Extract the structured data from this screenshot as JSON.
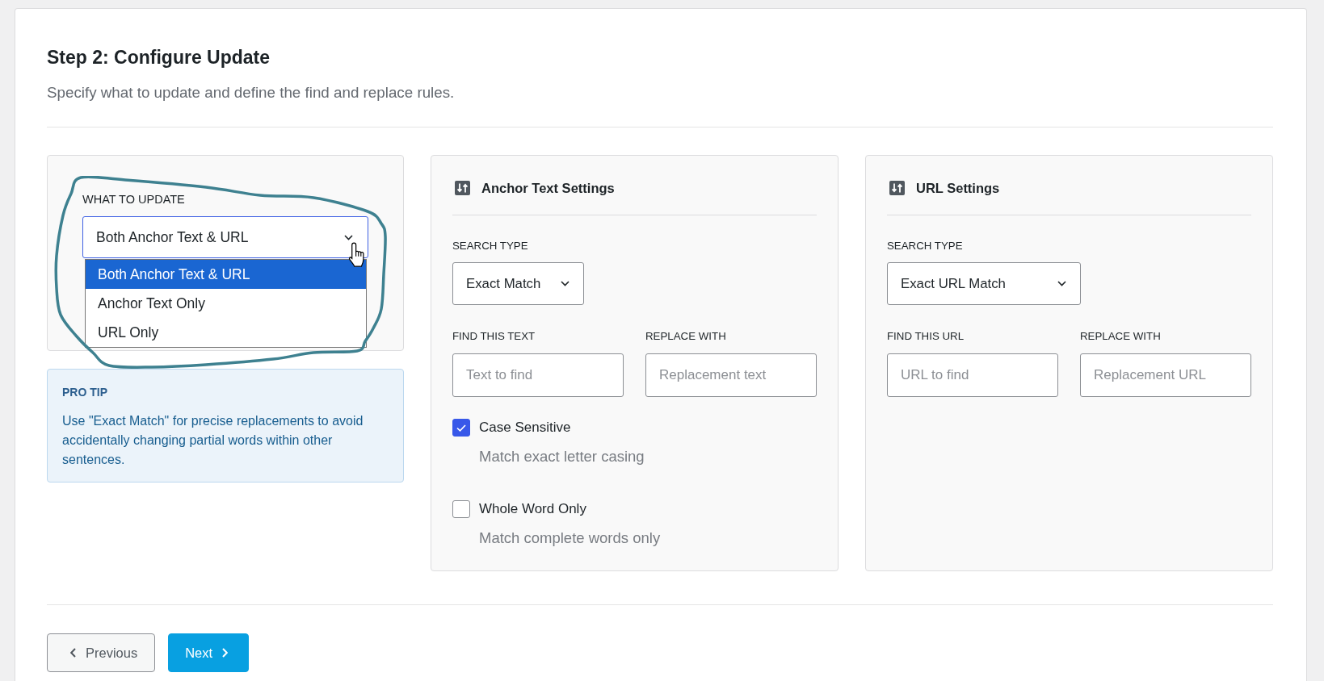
{
  "header": {
    "title": "Step 2: Configure Update",
    "subtitle": "Specify what to update and define the find and replace rules."
  },
  "update_panel": {
    "label": "WHAT TO UPDATE",
    "select": {
      "value": "Both Anchor Text & URL",
      "expanded": true,
      "options": [
        {
          "label": "Both Anchor Text & URL",
          "selected": true
        },
        {
          "label": "Anchor Text Only",
          "selected": false
        },
        {
          "label": "URL Only",
          "selected": false
        }
      ]
    }
  },
  "pro_tip": {
    "title": "PRO TIP",
    "text": "Use \"Exact Match\" for precise replacements to avoid accidentally changing partial words within other sentences."
  },
  "settings_panels": [
    {
      "title": "Anchor Text Settings",
      "search_type": {
        "label": "SEARCH TYPE",
        "value": "Exact Match"
      },
      "fields": [
        {
          "label": "FIND THIS TEXT",
          "placeholder": "Text to find"
        },
        {
          "label": "REPLACE WITH",
          "placeholder": "Replacement text"
        }
      ],
      "options": [
        {
          "label": "Case Sensitive",
          "description": "Match exact letter casing",
          "checked": true
        },
        {
          "label": "Whole Word Only",
          "description": "Match complete words only",
          "checked": false
        }
      ]
    },
    {
      "title": "URL Settings",
      "search_type": {
        "label": "SEARCH TYPE",
        "value": "Exact URL Match"
      },
      "fields": [
        {
          "label": "FIND THIS URL",
          "placeholder": "URL to find"
        },
        {
          "label": "REPLACE WITH",
          "placeholder": "Replacement URL"
        }
      ]
    }
  ],
  "buttons": [
    {
      "label": "Previous",
      "kind": "back"
    },
    {
      "label": "Next",
      "kind": "forward"
    }
  ]
}
